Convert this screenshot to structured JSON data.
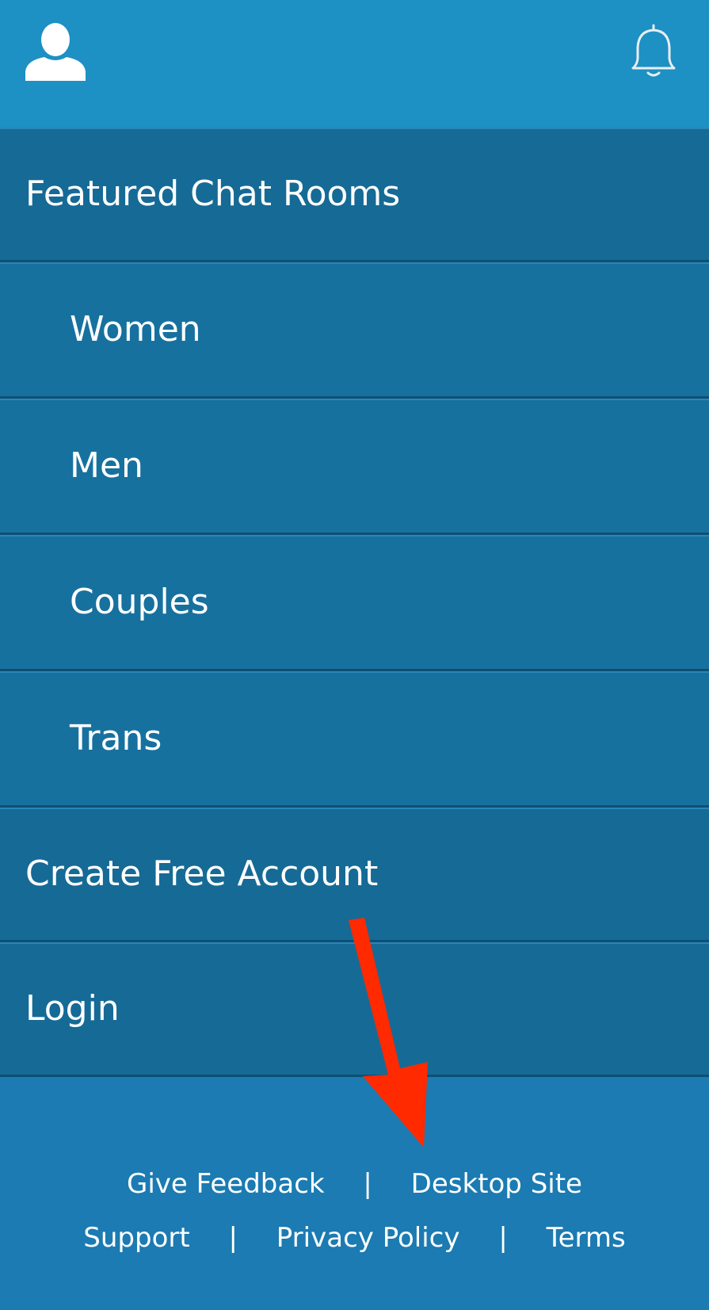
{
  "header": {
    "profile_icon": "user-icon",
    "notification_icon": "bell-icon",
    "background_color": "#1d90c4"
  },
  "menu": {
    "items": [
      {
        "label": "Featured Chat Rooms",
        "level": "top"
      },
      {
        "label": "Women",
        "level": "sub"
      },
      {
        "label": "Men",
        "level": "sub"
      },
      {
        "label": "Couples",
        "level": "sub"
      },
      {
        "label": "Trans",
        "level": "sub"
      },
      {
        "label": "Create Free Account",
        "level": "top"
      },
      {
        "label": "Login",
        "level": "top"
      }
    ],
    "top_color": "#166a96",
    "sub_color": "#17719f"
  },
  "footer": {
    "links": {
      "give_feedback": "Give Feedback",
      "desktop_site": "Desktop Site",
      "support": "Support",
      "privacy_policy": "Privacy Policy",
      "terms": "Terms"
    },
    "separator": "|"
  },
  "annotation": {
    "arrow_icon": "red-arrow-icon",
    "color": "#ff2a00"
  }
}
